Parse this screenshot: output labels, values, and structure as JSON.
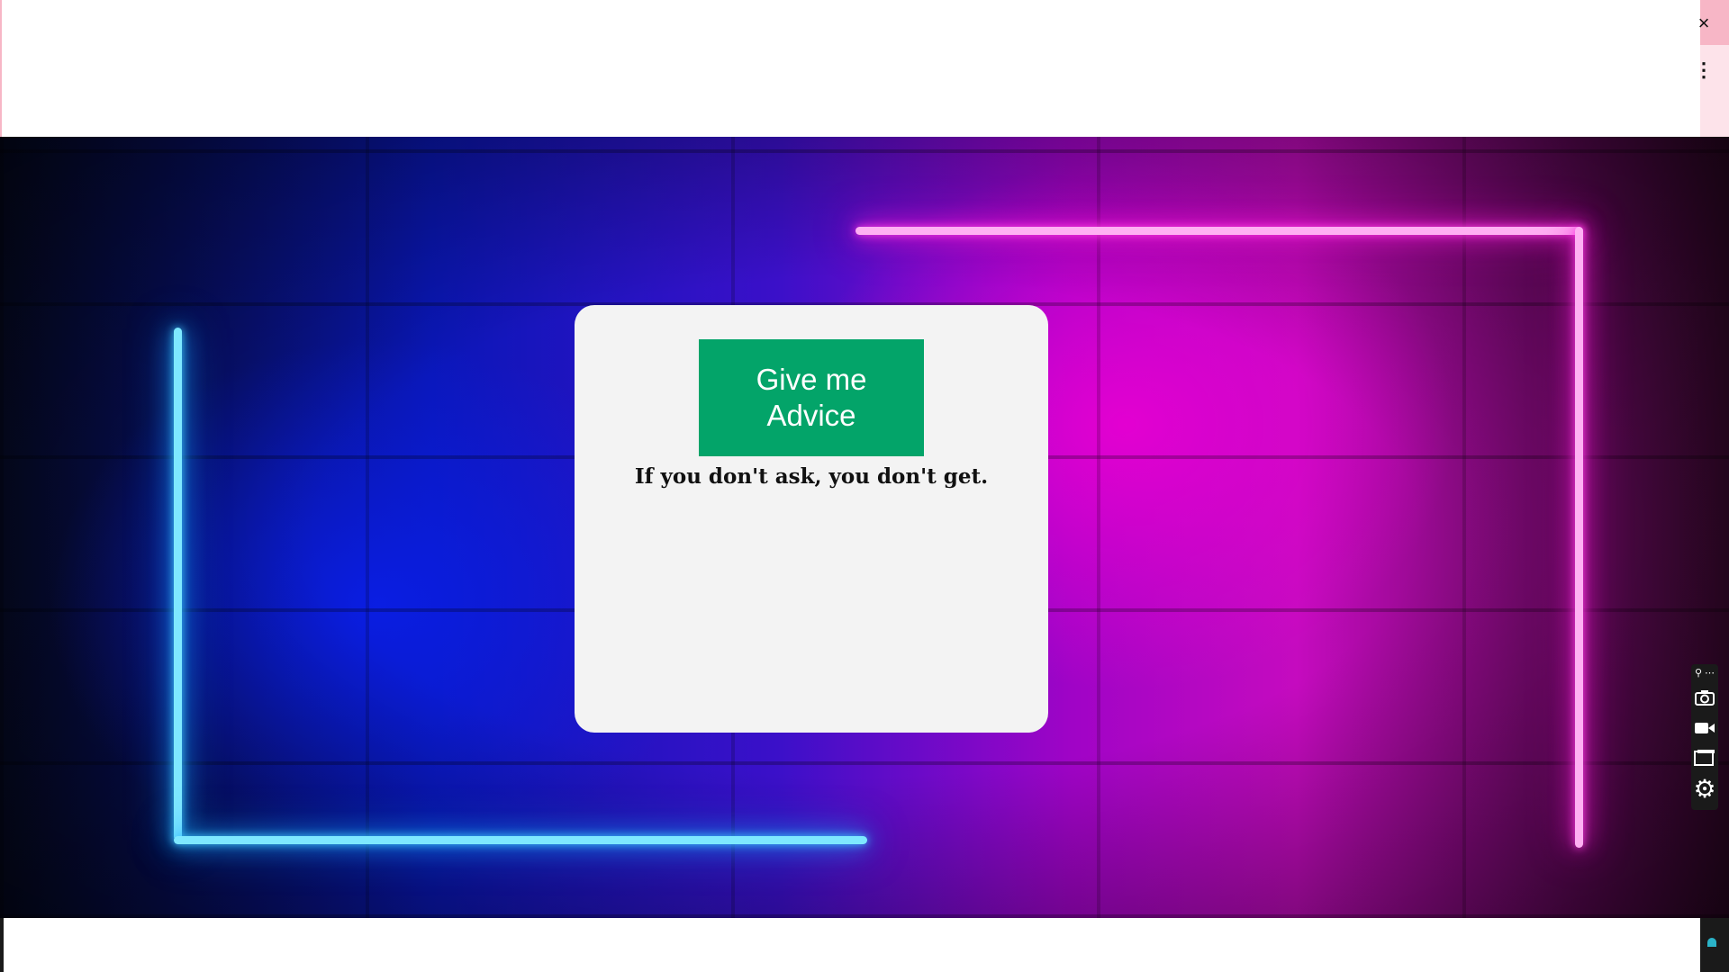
{
  "window": {
    "close_label": "×",
    "menu_label": "⋮"
  },
  "advice_card": {
    "button_label": "Give me Advice",
    "advice_text": "If you don't ask, you don't get."
  },
  "toolbar": {
    "items": [
      "mini-menu",
      "camera",
      "video",
      "window",
      "settings"
    ]
  },
  "colors": {
    "button_green": "#03a469",
    "card_bg": "#f3f3f3",
    "neon_blue": "#7ee8ff",
    "neon_pink": "#ffb0f3"
  }
}
